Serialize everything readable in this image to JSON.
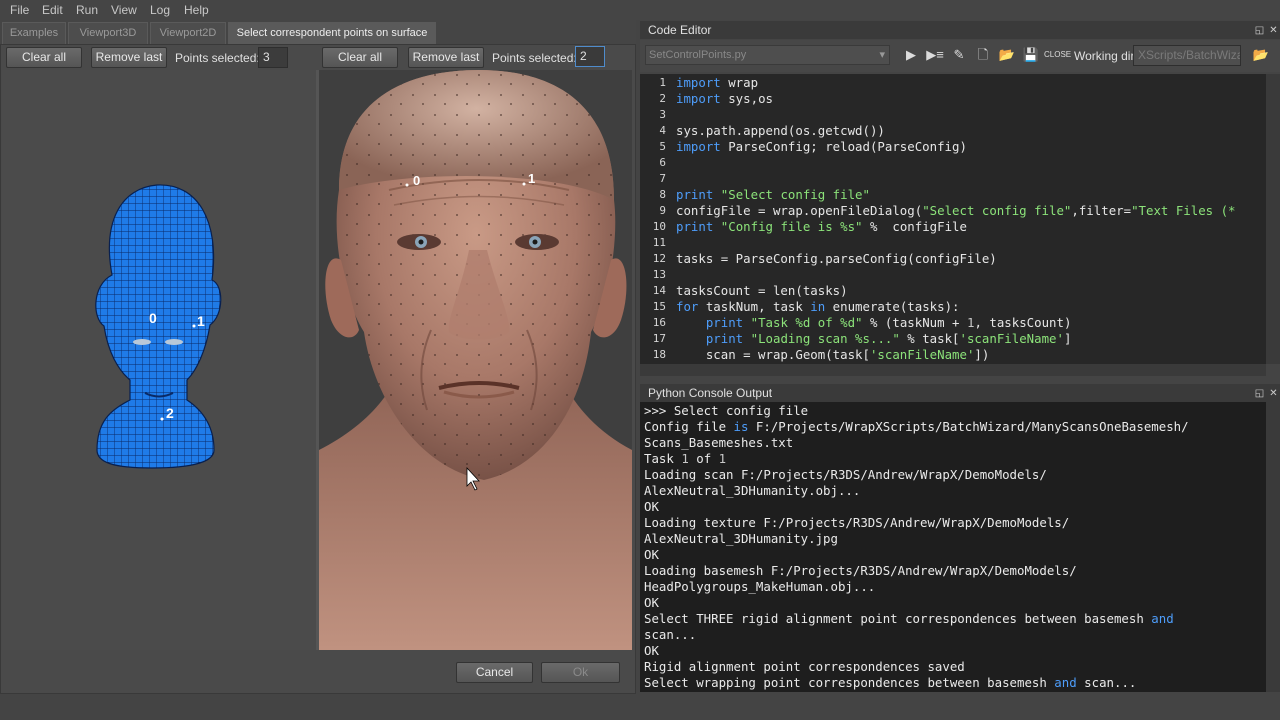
{
  "menu": [
    "File",
    "Edit",
    "Run",
    "View",
    "Log",
    "Help"
  ],
  "tabs": [
    "Examples",
    "Viewport3D",
    "Viewport2D",
    "Select correspondent points on surface"
  ],
  "left_toolbar": {
    "clear_all": "Clear all",
    "remove_last": "Remove last",
    "points_label": "Points selected:",
    "points_value": "3"
  },
  "right_toolbar": {
    "clear_all": "Clear all",
    "remove_last": "Remove last",
    "points_label": "Points selected:",
    "points_value": "2"
  },
  "left_points": [
    "0",
    "1",
    "2"
  ],
  "right_points": [
    "0",
    "1"
  ],
  "dialog_buttons": {
    "cancel": "Cancel",
    "ok": "Ok"
  },
  "code_editor": {
    "title": "Code Editor",
    "file": "SetControlPoints.py",
    "working_dir_label": "Working dir",
    "working_dir_value": "XScripts/BatchWizard",
    "toolbar_icons": [
      "run-icon",
      "run-selection-icon",
      "clear-icon",
      "new-file-icon",
      "open-file-icon",
      "save-icon",
      "close-file-icon"
    ],
    "lines": [
      [
        [
          "kw",
          "import"
        ],
        [
          "t",
          " wrap"
        ]
      ],
      [
        [
          "kw",
          "import"
        ],
        [
          "t",
          " sys,os"
        ]
      ],
      [],
      [
        [
          "t",
          "sys.path.append(os.getcwd())"
        ]
      ],
      [
        [
          "kw",
          "import"
        ],
        [
          "t",
          " ParseConfig; reload(ParseConfig)"
        ]
      ],
      [],
      [],
      [
        [
          "kw",
          "print"
        ],
        [
          "t",
          " "
        ],
        [
          "str",
          "\"Select config file\""
        ]
      ],
      [
        [
          "t",
          "configFile = wrap.openFileDialog("
        ],
        [
          "str",
          "\"Select config file\""
        ],
        [
          "t",
          ",filter="
        ],
        [
          "str",
          "\"Text Files (*"
        ]
      ],
      [
        [
          "kw",
          "print"
        ],
        [
          "t",
          " "
        ],
        [
          "str",
          "\"Config file is %s\""
        ],
        [
          "t",
          " %  configFile"
        ]
      ],
      [],
      [
        [
          "t",
          "tasks = ParseConfig.parseConfig(configFile)"
        ]
      ],
      [],
      [
        [
          "t",
          "tasksCount = len(tasks)"
        ]
      ],
      [
        [
          "kw",
          "for"
        ],
        [
          "t",
          " taskNum, task "
        ],
        [
          "kw",
          "in"
        ],
        [
          "t",
          " enumerate(tasks):"
        ]
      ],
      [
        [
          "t",
          "    "
        ],
        [
          "kw",
          "print"
        ],
        [
          "t",
          " "
        ],
        [
          "str",
          "\"Task %d of %d\""
        ],
        [
          "t",
          " % (taskNum + "
        ],
        [
          "num",
          "1"
        ],
        [
          "t",
          ", tasksCount)"
        ]
      ],
      [
        [
          "t",
          "    "
        ],
        [
          "kw",
          "print"
        ],
        [
          "t",
          " "
        ],
        [
          "str",
          "\"Loading scan %s...\""
        ],
        [
          "t",
          " % task["
        ],
        [
          "str",
          "'scanFileName'"
        ],
        [
          "t",
          "]"
        ]
      ],
      [
        [
          "t",
          "    scan = wrap.Geom(task["
        ],
        [
          "str",
          "'scanFileName'"
        ],
        [
          "t",
          "])"
        ]
      ]
    ]
  },
  "console": {
    "title": "Python Console Output",
    "lines": [
      [
        [
          "t",
          ">>> Select config file"
        ]
      ],
      [
        [
          "t",
          "Config file "
        ],
        [
          "kw",
          "is"
        ],
        [
          "t",
          " F:/Projects/WrapXScripts/BatchWizard/ManyScansOneBasemesh/"
        ]
      ],
      [
        [
          "t",
          "Scans_Basemeshes.txt"
        ]
      ],
      [
        [
          "t",
          "Task "
        ],
        [
          "num",
          "1"
        ],
        [
          "t",
          " of "
        ],
        [
          "num",
          "1"
        ]
      ],
      [
        [
          "t",
          "Loading scan F:/Projects/R3DS/Andrew/WrapX/DemoModels/"
        ]
      ],
      [
        [
          "t",
          "AlexNeutral_3DHumanity.obj..."
        ]
      ],
      [
        [
          "t",
          "OK"
        ]
      ],
      [
        [
          "t",
          "Loading texture F:/Projects/R3DS/Andrew/WrapX/DemoModels/"
        ]
      ],
      [
        [
          "t",
          "AlexNeutral_3DHumanity.jpg"
        ]
      ],
      [
        [
          "t",
          "OK"
        ]
      ],
      [
        [
          "t",
          "Loading basemesh F:/Projects/R3DS/Andrew/WrapX/DemoModels/"
        ]
      ],
      [
        [
          "t",
          "HeadPolygroups_MakeHuman.obj..."
        ]
      ],
      [
        [
          "t",
          "OK"
        ]
      ],
      [
        [
          "t",
          "Select THREE rigid alignment point correspondences between basemesh "
        ],
        [
          "kw",
          "and"
        ]
      ],
      [
        [
          "t",
          "scan..."
        ]
      ],
      [
        [
          "t",
          "OK"
        ]
      ],
      [
        [
          "t",
          "Rigid alignment point correspondences saved"
        ]
      ],
      [
        [
          "t",
          "Select wrapping point correspondences between basemesh "
        ],
        [
          "kw",
          "and"
        ],
        [
          "t",
          " scan..."
        ]
      ]
    ]
  }
}
